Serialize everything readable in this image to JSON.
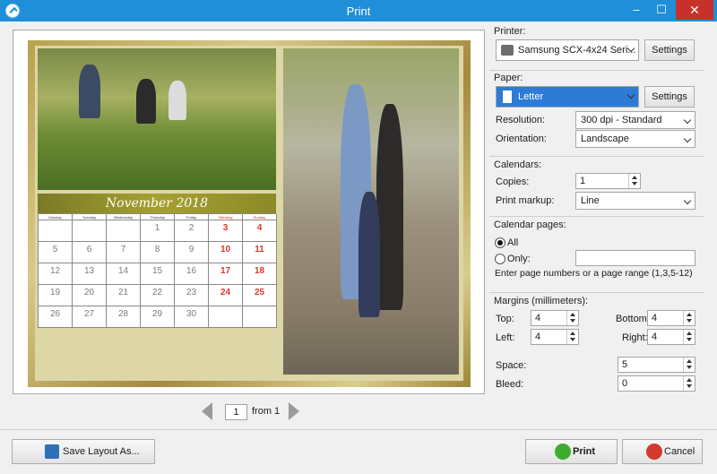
{
  "window": {
    "title": "Print",
    "minimize": "–",
    "maximize": "☐",
    "close": "✕"
  },
  "calendar_preview": {
    "month_title": "November 2018",
    "day_names": [
      "Monday",
      "Tuesday",
      "Wednesday",
      "Thursday",
      "Friday",
      "Saturday",
      "Sunday"
    ],
    "weeks": [
      [
        "",
        "",
        "",
        "1",
        "2",
        "3",
        "4"
      ],
      [
        "5",
        "6",
        "7",
        "8",
        "9",
        "10",
        "11"
      ],
      [
        "12",
        "13",
        "14",
        "15",
        "16",
        "17",
        "18"
      ],
      [
        "19",
        "20",
        "21",
        "22",
        "23",
        "24",
        "25"
      ],
      [
        "26",
        "27",
        "28",
        "29",
        "30",
        "",
        ""
      ]
    ]
  },
  "pager": {
    "page": "1",
    "from_text": "from 1"
  },
  "printer": {
    "group_label": "Printer:",
    "selected": "Samsung SCX-4x24 Seri...",
    "settings_label": "Settings"
  },
  "paper": {
    "group_label": "Paper:",
    "selected": "Letter",
    "settings_label": "Settings",
    "resolution_label": "Resolution:",
    "resolution_value": "300 dpi - Standard",
    "orientation_label": "Orientation:",
    "orientation_value": "Landscape"
  },
  "calendars": {
    "group_label": "Calendars:",
    "copies_label": "Copies:",
    "copies_value": "1",
    "markup_label": "Print markup:",
    "markup_value": "Line"
  },
  "calendar_pages": {
    "group_label": "Calendar pages:",
    "all_label": "All",
    "only_label": "Only:",
    "only_value": "",
    "hint": "Enter page numbers or a page range (1,3,5-12)"
  },
  "margins": {
    "group_label": "Margins (millimeters):",
    "top_label": "Top:",
    "top_value": "4",
    "bottom_label": "Bottom:",
    "bottom_value": "4",
    "left_label": "Left:",
    "left_value": "4",
    "right_label": "Right:",
    "right_value": "4",
    "space_label": "Space:",
    "space_value": "5",
    "bleed_label": "Bleed:",
    "bleed_value": "0"
  },
  "actions": {
    "save_layout": "Save Layout As...",
    "print": "Print",
    "cancel": "Cancel"
  },
  "colors": {
    "titlebar": "#1e8fd8",
    "paper_selected": "#2e7bd6",
    "print_icon": "#3dad2e",
    "cancel_icon": "#d23a2f"
  }
}
